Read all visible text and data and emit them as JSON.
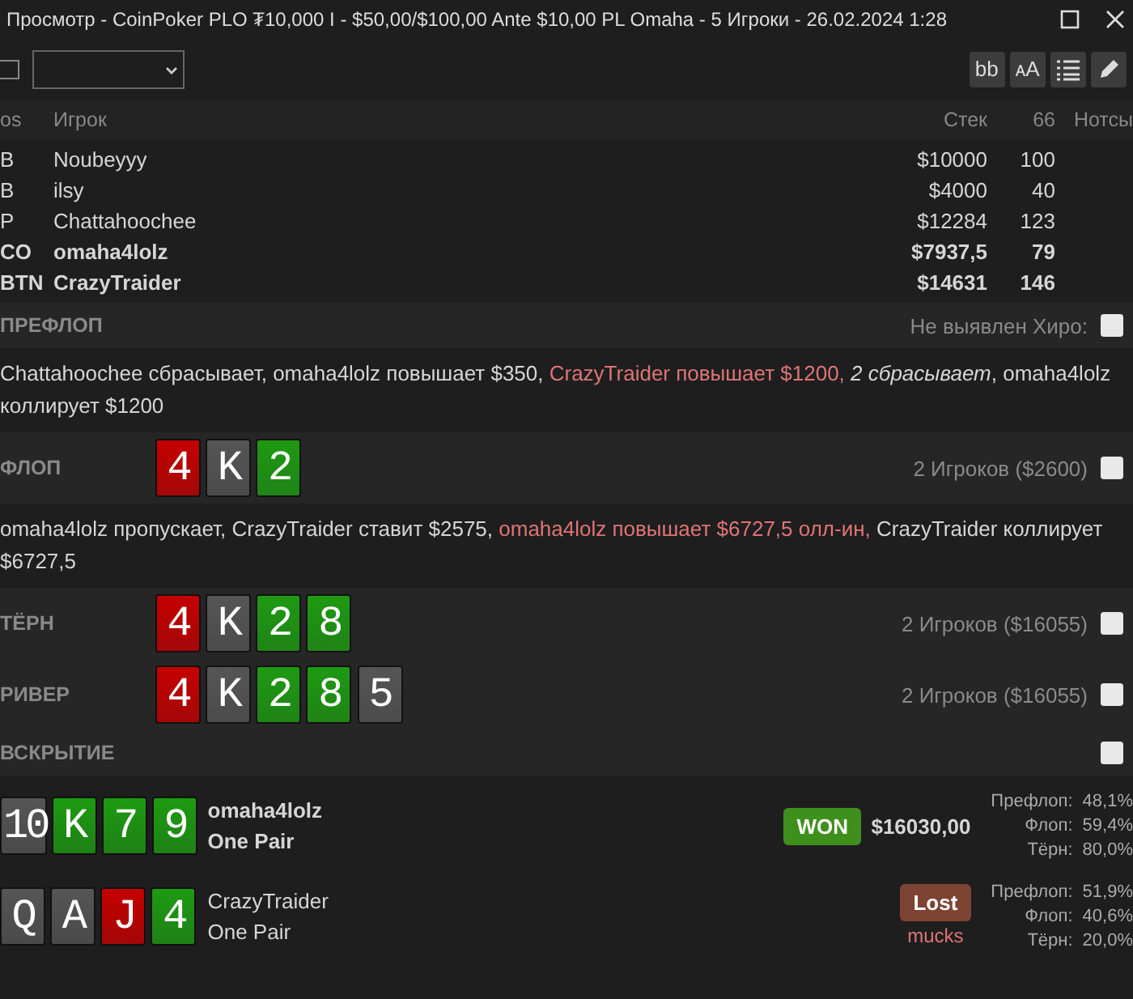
{
  "window": {
    "title": "Просмотр - CoinPoker PLO ₮10,000 I - $50,00/$100,00 Ante $10,00 PL Omaha - 5 Игроки - 26.02.2024 1:28"
  },
  "toolbar": {
    "checkbox": {
      "checked": false
    },
    "buttons": [
      {
        "kind": "text",
        "label": "bb"
      },
      {
        "kind": "text",
        "label": "ᴀA"
      },
      {
        "kind": "list"
      },
      {
        "kind": "pencil"
      }
    ]
  },
  "players": {
    "columns": [
      "os",
      "Игрок",
      "Стек",
      "66",
      "Нотсы"
    ],
    "rows": [
      {
        "pos": "B",
        "name": "Noubeyyy",
        "stack": "$10000",
        "count": "100",
        "highlighted": false
      },
      {
        "pos": "B",
        "name": "ilsy",
        "stack": "$4000",
        "count": "40",
        "highlighted": false
      },
      {
        "pos": "P",
        "name": "Chattahoochee",
        "stack": "$12284",
        "count": "123",
        "highlighted": false
      },
      {
        "pos": "CO",
        "name": "omaha4lolz",
        "stack": "$7937,5",
        "count": "79",
        "highlighted": true
      },
      {
        "pos": "BTN",
        "name": "CrazyTraider",
        "stack": "$14631",
        "count": "146",
        "highlighted": true
      }
    ]
  },
  "streets": [
    {
      "name": "ПРЕФЛОП",
      "info": "Не выявлен Хиро:",
      "note_checked": false,
      "actions": [
        {
          "kind": "plain",
          "text": "Chattahoochee сбрасывает, omaha4lolz повышает $350, "
        },
        {
          "kind": "hero",
          "text": "CrazyTraider повышает $1200,"
        },
        {
          "kind": "italic",
          "text": " 2 сбрасывает"
        },
        {
          "kind": "plain",
          "text": ", omaha4lolz коллирует $1200"
        }
      ]
    },
    {
      "name": "ФЛОП",
      "cards": [
        {
          "rank": "4",
          "color": "#c40000"
        },
        {
          "rank": "K",
          "color": "#555555"
        },
        {
          "rank": "2",
          "color": "#1e9a12"
        }
      ],
      "info": "2 Игроков ($2600)",
      "note_checked": false,
      "actions": [
        {
          "kind": "plain",
          "text": "omaha4lolz пропускает, CrazyTraider ставит $2575, "
        },
        {
          "kind": "hero",
          "text": "omaha4lolz повышает $6727,5 олл-ин,"
        },
        {
          "kind": "plain",
          "text": " CrazyTraider коллирует $6727,5"
        }
      ]
    },
    {
      "name": "ТЁРН",
      "cards": [
        {
          "rank": "4",
          "color": "#c40000"
        },
        {
          "rank": "K",
          "color": "#555555"
        },
        {
          "rank": "2",
          "color": "#1e9a12"
        },
        {
          "rank": "8",
          "color": "#1e9a12"
        }
      ],
      "info": "2 Игроков ($16055)",
      "note_checked": false
    },
    {
      "name": "РИВЕР",
      "cards": [
        {
          "rank": "4",
          "color": "#c40000"
        },
        {
          "rank": "K",
          "color": "#555555"
        },
        {
          "rank": "2",
          "color": "#1e9a12"
        },
        {
          "rank": "8",
          "color": "#1e9a12"
        },
        {
          "rank": "5",
          "color": "#555555"
        }
      ],
      "info": "2 Игроков ($16055)",
      "note_checked": false
    },
    {
      "name": "ВСКРЫТИЕ",
      "note_checked": false
    }
  ],
  "showdown": [
    {
      "cards": [
        {
          "rank": "10",
          "color": "#555555"
        },
        {
          "rank": "K",
          "color": "#1e9a12"
        },
        {
          "rank": "7",
          "color": "#1e9a12"
        },
        {
          "rank": "9",
          "color": "#1e9a12"
        }
      ],
      "name": "omaha4lolz",
      "hand": "One Pair",
      "highlighted": true,
      "result": {
        "kind": "won",
        "label": "WON"
      },
      "amount": "$16030,00",
      "equity": [
        {
          "street": "Префлоп:",
          "value": "48,1%"
        },
        {
          "street": "Флоп:",
          "value": "59,4%"
        },
        {
          "street": "Тёрн:",
          "value": "80,0%"
        }
      ]
    },
    {
      "cards": [
        {
          "rank": "Q",
          "color": "#555555"
        },
        {
          "rank": "A",
          "color": "#555555"
        },
        {
          "rank": "J",
          "color": "#c40000"
        },
        {
          "rank": "4",
          "color": "#1e9a12"
        }
      ],
      "name": "CrazyTraider",
      "hand": "One Pair",
      "highlighted": false,
      "result": {
        "kind": "lost",
        "label": "Lost"
      },
      "note": "mucks",
      "equity": [
        {
          "street": "Префлоп:",
          "value": "51,9%"
        },
        {
          "street": "Флоп:",
          "value": "40,6%"
        },
        {
          "street": "Тёрн:",
          "value": "20,0%"
        }
      ]
    }
  ]
}
